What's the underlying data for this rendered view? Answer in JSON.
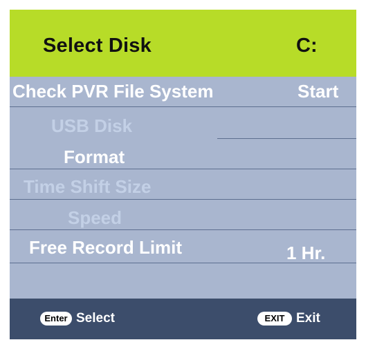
{
  "header": {
    "title": "Select Disk",
    "value": "C:"
  },
  "rows": [
    {
      "label": "Check PVR File System",
      "value": "Start"
    },
    {
      "label": "USB Disk",
      "value": ""
    },
    {
      "label": "Format",
      "value": ""
    },
    {
      "label": "Time Shift Size",
      "value": ""
    },
    {
      "label": "Speed",
      "value": ""
    },
    {
      "label": "Free Record Limit",
      "value": "1 Hr."
    },
    {
      "label": "",
      "value": ""
    }
  ],
  "footer": {
    "enter_key": "Enter",
    "enter_label": "Select",
    "exit_key": "EXIT",
    "exit_label": "Exit"
  },
  "colors": {
    "header_bg": "#b7dc28",
    "panel_bg": "#a9b6cf",
    "footer_bg": "#3c4d6b",
    "disabled_text": "#c3d0e6",
    "enabled_text": "#ffffff"
  }
}
